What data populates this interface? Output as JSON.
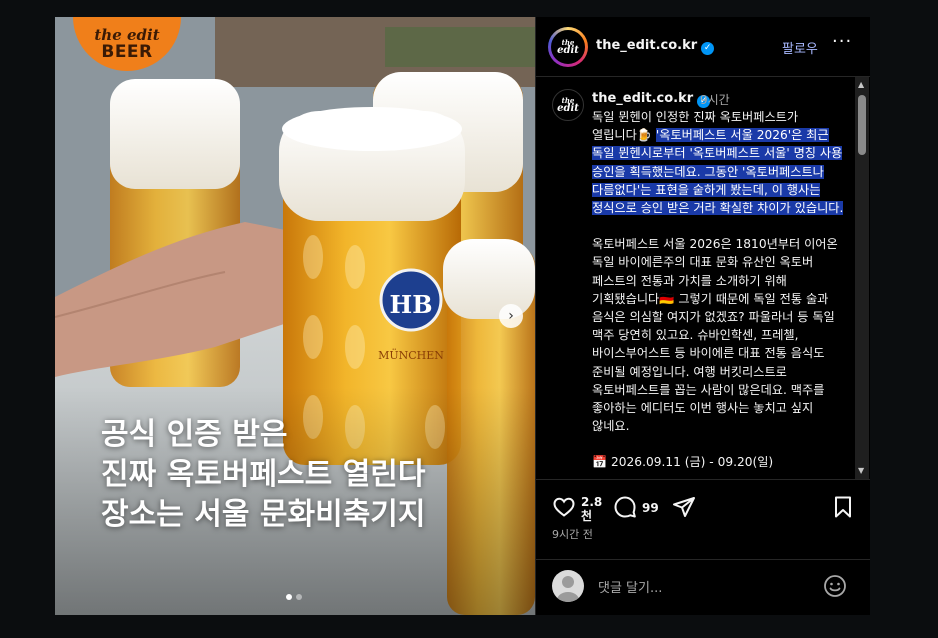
{
  "brand": {
    "line1": "the edit",
    "line2": "BEER"
  },
  "media": {
    "overlay_lines": [
      "공식 인증 받은",
      "진짜 옥토버페스트 열린다",
      "장소는 서울 문화비축기지"
    ],
    "mug_logo": "HB",
    "mug_text": "MÜNCHEN",
    "next_glyph": "›",
    "slide_count": 2,
    "active_slide": 1
  },
  "header": {
    "logo_text_1": "the",
    "logo_text_2": "edit",
    "username": "the_edit.co.kr",
    "follow_label": "팔로우",
    "more_label": "···"
  },
  "caption": {
    "username": "the_edit.co.kr",
    "time": "9시간",
    "para1_plain": "독일 뮌헨이 인정한 진짜 옥토버페스트가 열립니다🍺 ",
    "para1_highlight": "'옥토버페스트 서울 2026'은 최근 독일 뮌헨시로부터 '옥토버페스트 서울' 명칭 사용 승인을 획득했는데요. 그동안 '옥토버페스트나 다름없다'는 표현을 숱하게 봤는데, 이 행사는 정식으로 승인 받은 거라 확실한 차이가 있습니다.",
    "para2": "옥토버페스트 서울 2026은 1810년부터 이어온 독일 바이에른주의 대표 문화 유산인 옥토버 페스트의 전통과 가치를 소개하기 위해 기획됐습니다🇩🇪 그렇기 때문에 독일 전통 술과 음식은 의심할 여지가 없겠죠? 파울라너 등 독일 맥주 당연히 있고요. 슈바인학센, 프레첼, 바이스부어스트 등 바이에른 대표 전통 음식도 준비될 예정입니다. 여행 버킷리스트로 옥토버페스트를 꼽는 사람이 많은데요. 맥주를 좋아하는 에디터도 이번 행사는 놓치고 싶지 않네요.",
    "para3": "📅 2026.09.11 (금) - 09.20(일)"
  },
  "scrollbar": {
    "up": "▲",
    "down": "▼"
  },
  "actions": {
    "likes_line1": "2.8",
    "likes_line2": "천",
    "comments": "99",
    "posted": "9시간 전"
  },
  "comment_box": {
    "placeholder": "댓글 달기..."
  },
  "colors": {
    "accent": "#0095f6",
    "follow": "#a8b8ff",
    "highlight": "#1a3aa8",
    "badge": "#f07f1a"
  }
}
